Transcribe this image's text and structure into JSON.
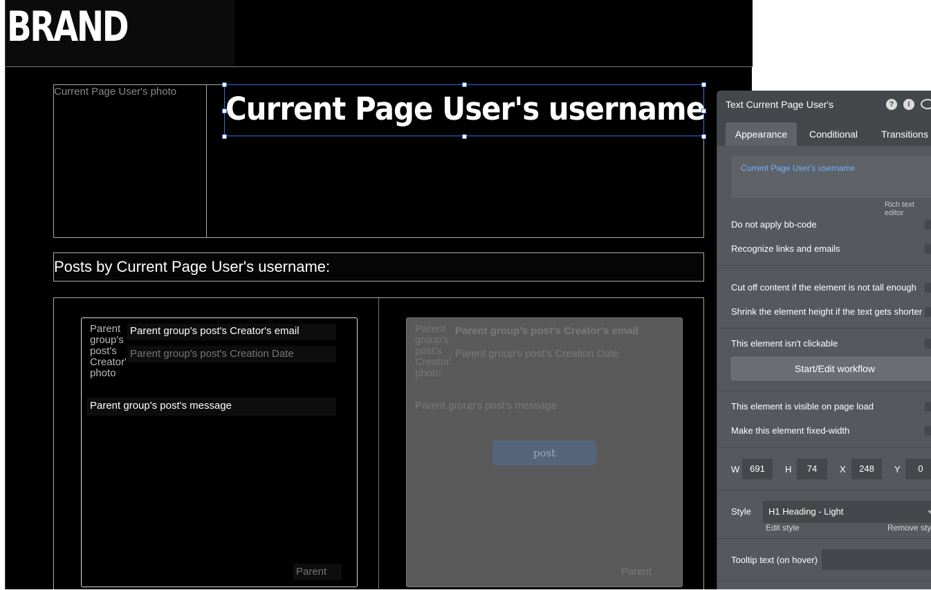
{
  "canvas": {
    "brand": "BRAND",
    "profile": {
      "photo_label": "Current Page User's photo",
      "username": "Current Page User's username"
    },
    "posts_title": "Posts by Current Page User's username:",
    "cells": [
      {
        "photo": "Parent group's post's Creator's photo",
        "email": "Parent group's post's Creator's email",
        "date": "Parent group's post's Creation Date",
        "message": "Parent group's post's message",
        "parent": "Parent"
      },
      {
        "photo": "Parent group's post's Creator's photo",
        "email": "Parent group's post's Creator's email",
        "date": "Parent group's post's Creation Date",
        "message": "Parent group's post's message",
        "post_button": "post",
        "parent": "Parent"
      }
    ]
  },
  "property_panel": {
    "title": "Text Current Page User's",
    "tabs": [
      "Appearance",
      "Conditional",
      "Transitions"
    ],
    "active_tab": "Appearance",
    "content_value": "Current Page User's username",
    "rich_text_link": "Rich text editor",
    "options": {
      "bbcode": "Do not apply bb-code",
      "links": "Recognize links and emails",
      "cutoff": "Cut off content if the element is not tall enough",
      "shrink": "Shrink the element height if the text gets shorter",
      "not_clickable": "This element isn't clickable",
      "visible": "This element is visible on page load",
      "fixed_width": "Make this element fixed-width"
    },
    "workflow_button": "Start/Edit workflow",
    "dimensions": {
      "w_label": "W",
      "w": "691",
      "h_label": "H",
      "h": "74",
      "x_label": "X",
      "x": "248",
      "y_label": "Y",
      "y": "0"
    },
    "style": {
      "label": "Style",
      "value": "H1 Heading - Light",
      "edit_link": "Edit style",
      "remove_link": "Remove style"
    },
    "tooltip_label": "Tooltip text (on hover)",
    "colors": {
      "selection": "#3a6fd8",
      "panel_bg": "#55595d",
      "link": "#6fb1ff",
      "post_button": "#55657c"
    }
  }
}
